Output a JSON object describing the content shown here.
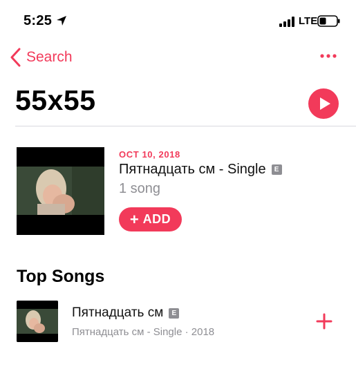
{
  "status_bar": {
    "time": "5:25",
    "network": "LTE"
  },
  "nav": {
    "back_label": "Search"
  },
  "header": {
    "title": "55x55"
  },
  "album": {
    "release_date": "OCT 10, 2018",
    "title": "Пятнадцать см - Single",
    "explicit": "E",
    "song_count": "1 song",
    "add_plus": "+",
    "add_label": "ADD"
  },
  "top_songs": {
    "title": "Top Songs",
    "items": [
      {
        "title": "Пятнадцать см",
        "explicit": "E",
        "subtitle": "Пятнадцать см - Single · 2018"
      }
    ]
  },
  "colors": {
    "accent": "#f23a5a",
    "secondary_text": "#8e8e93"
  },
  "icons": [
    "location-arrow-icon",
    "signal-icon",
    "battery-icon",
    "chevron-left-icon",
    "more-icon",
    "play-icon",
    "plus-icon"
  ]
}
